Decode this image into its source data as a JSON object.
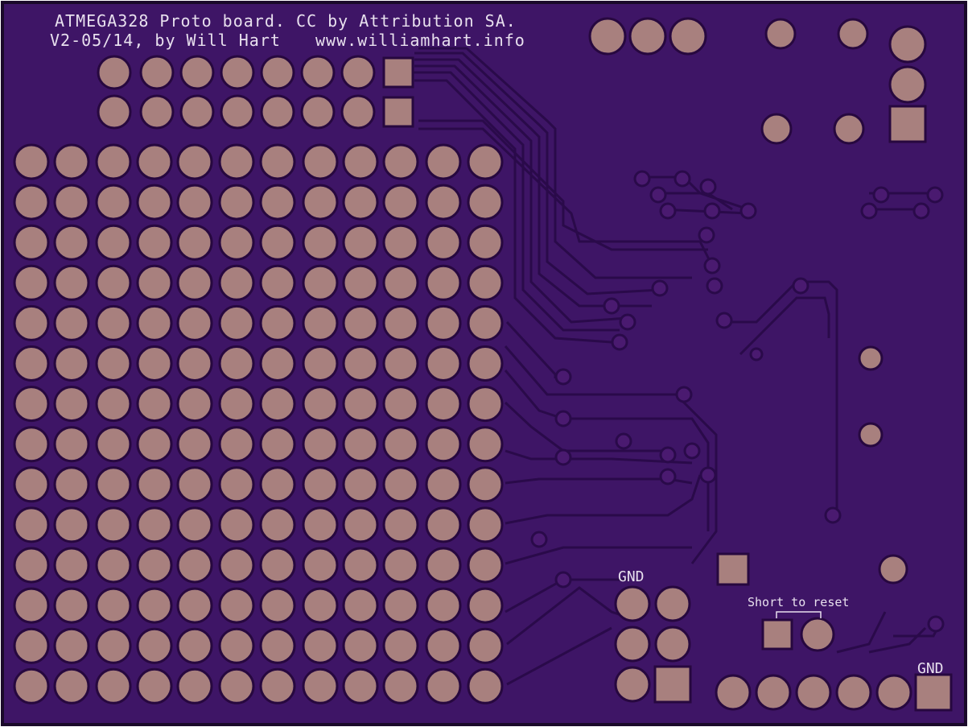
{
  "silkscreen": {
    "title_line1": "ATMEGA328 Proto board. CC by Attribution SA.",
    "title_line2_left": "V2-05/14, by Will Hart",
    "title_line2_right": "www.williamhart.info",
    "gnd_label_header": "GND",
    "short_to_reset": "Short to reset",
    "gnd_label_bottom_right": "GND"
  },
  "colors": {
    "board": "#3e1566",
    "board_edge": "#1a0a2a",
    "trace": "#2a0a4a",
    "pad": "#a8807e",
    "pad_outline": "#27083f",
    "silk": "#e8e0ee"
  },
  "proto_grid": {
    "rows": 14,
    "columns": 12
  },
  "top_header": {
    "rows": 2,
    "columns": 8
  }
}
